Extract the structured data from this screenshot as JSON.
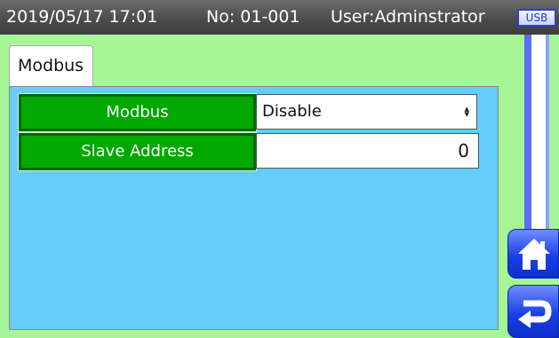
{
  "header": {
    "datetime": "2019/05/17 17:01",
    "machine_no": "No: 01-001",
    "user": "User:Adminstrator",
    "usb_label": "USB"
  },
  "tabs": [
    {
      "label": "Modbus",
      "selected": true
    }
  ],
  "settings": [
    {
      "label": "Modbus",
      "value": "Disable",
      "kind": "select"
    },
    {
      "label": "Slave Address",
      "value": "0",
      "kind": "number"
    }
  ],
  "nav": {
    "home_icon": "home-icon",
    "back_icon": "return-arrow-icon"
  },
  "colors": {
    "background": "#a6f596",
    "panel": "#66cdfb",
    "label_green": "#00a800",
    "nav_blue": "#1b3fe6"
  }
}
